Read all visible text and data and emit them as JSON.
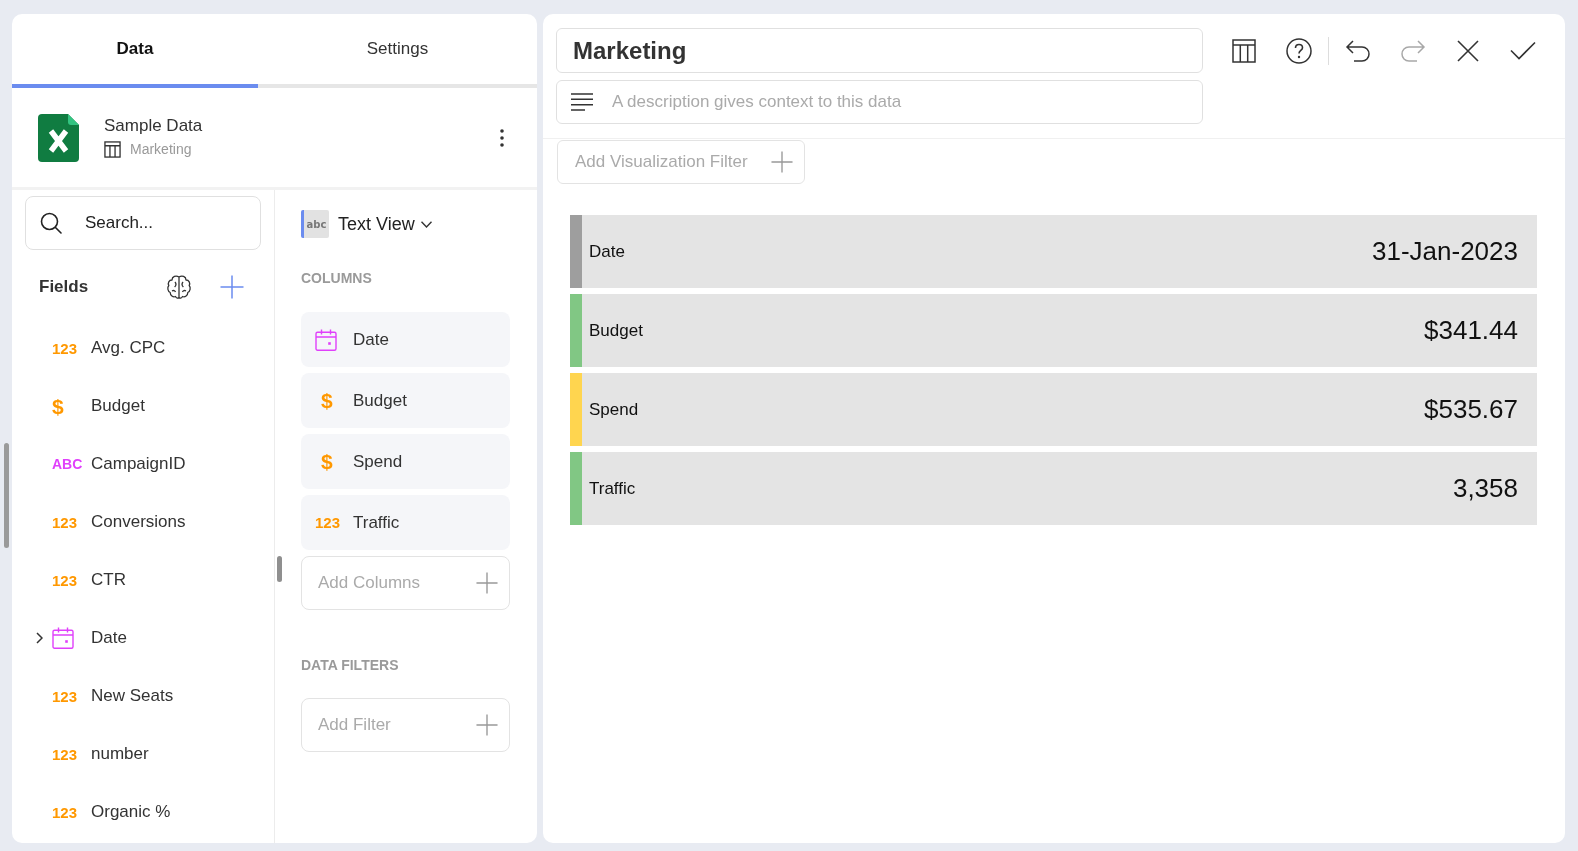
{
  "tabs": [
    {
      "label": "Data",
      "selected": true
    },
    {
      "label": "Settings",
      "selected": false
    }
  ],
  "data_source": {
    "name": "Sample Data",
    "table": "Marketing"
  },
  "fields": {
    "search": {
      "placeholder": "Search..."
    },
    "title": "Fields",
    "items": [
      {
        "label": "Avg. CPC",
        "kind": "number",
        "badge": "123",
        "expandable": false
      },
      {
        "label": "Budget",
        "kind": "currency",
        "badge": "$",
        "expandable": false
      },
      {
        "label": "CampaignID",
        "kind": "text",
        "badge": "ABC",
        "expandable": false
      },
      {
        "label": "Conversions",
        "kind": "number",
        "badge": "123",
        "expandable": false
      },
      {
        "label": "CTR",
        "kind": "number",
        "badge": "123",
        "expandable": false
      },
      {
        "label": "Date",
        "kind": "date",
        "expandable": true
      },
      {
        "label": "New Seats",
        "kind": "number",
        "badge": "123",
        "expandable": false
      },
      {
        "label": "number",
        "kind": "number",
        "badge": "123",
        "expandable": false
      },
      {
        "label": "Organic %",
        "kind": "number",
        "badge": "123",
        "expandable": false
      }
    ]
  },
  "visualization": {
    "view_icon_label": "abc",
    "view_label": "Text View",
    "columns_title": "COLUMNS",
    "columns": [
      {
        "label": "Date",
        "kind": "date"
      },
      {
        "label": "Budget",
        "kind": "currency",
        "badge": "$"
      },
      {
        "label": "Spend",
        "kind": "currency",
        "badge": "$"
      },
      {
        "label": "Traffic",
        "kind": "number",
        "badge": "123"
      }
    ],
    "add_columns": "Add Columns",
    "filters_title": "DATA FILTERS",
    "add_filter": "Add Filter"
  },
  "editor": {
    "title": "Marketing",
    "description": {
      "placeholder": "A description gives context to this data"
    },
    "toolbar": [
      {
        "kind": "grid",
        "disabled": false
      },
      {
        "kind": "help",
        "disabled": false
      },
      {
        "kind": "undo",
        "disabled": false
      },
      {
        "kind": "redo",
        "disabled": true
      },
      {
        "kind": "close",
        "disabled": false
      },
      {
        "kind": "confirm",
        "disabled": false
      }
    ],
    "add_filter": "Add Visualization Filter",
    "rows": [
      {
        "label": "Date",
        "value": "31-Jan-2023",
        "color": "#9e9e9e"
      },
      {
        "label": "Budget",
        "value": "$341.44",
        "color": "#81c784"
      },
      {
        "label": "Spend",
        "value": "$535.67",
        "color": "#ffd54f"
      },
      {
        "label": "Traffic",
        "value": "3,358",
        "color": "#81c784"
      }
    ]
  }
}
